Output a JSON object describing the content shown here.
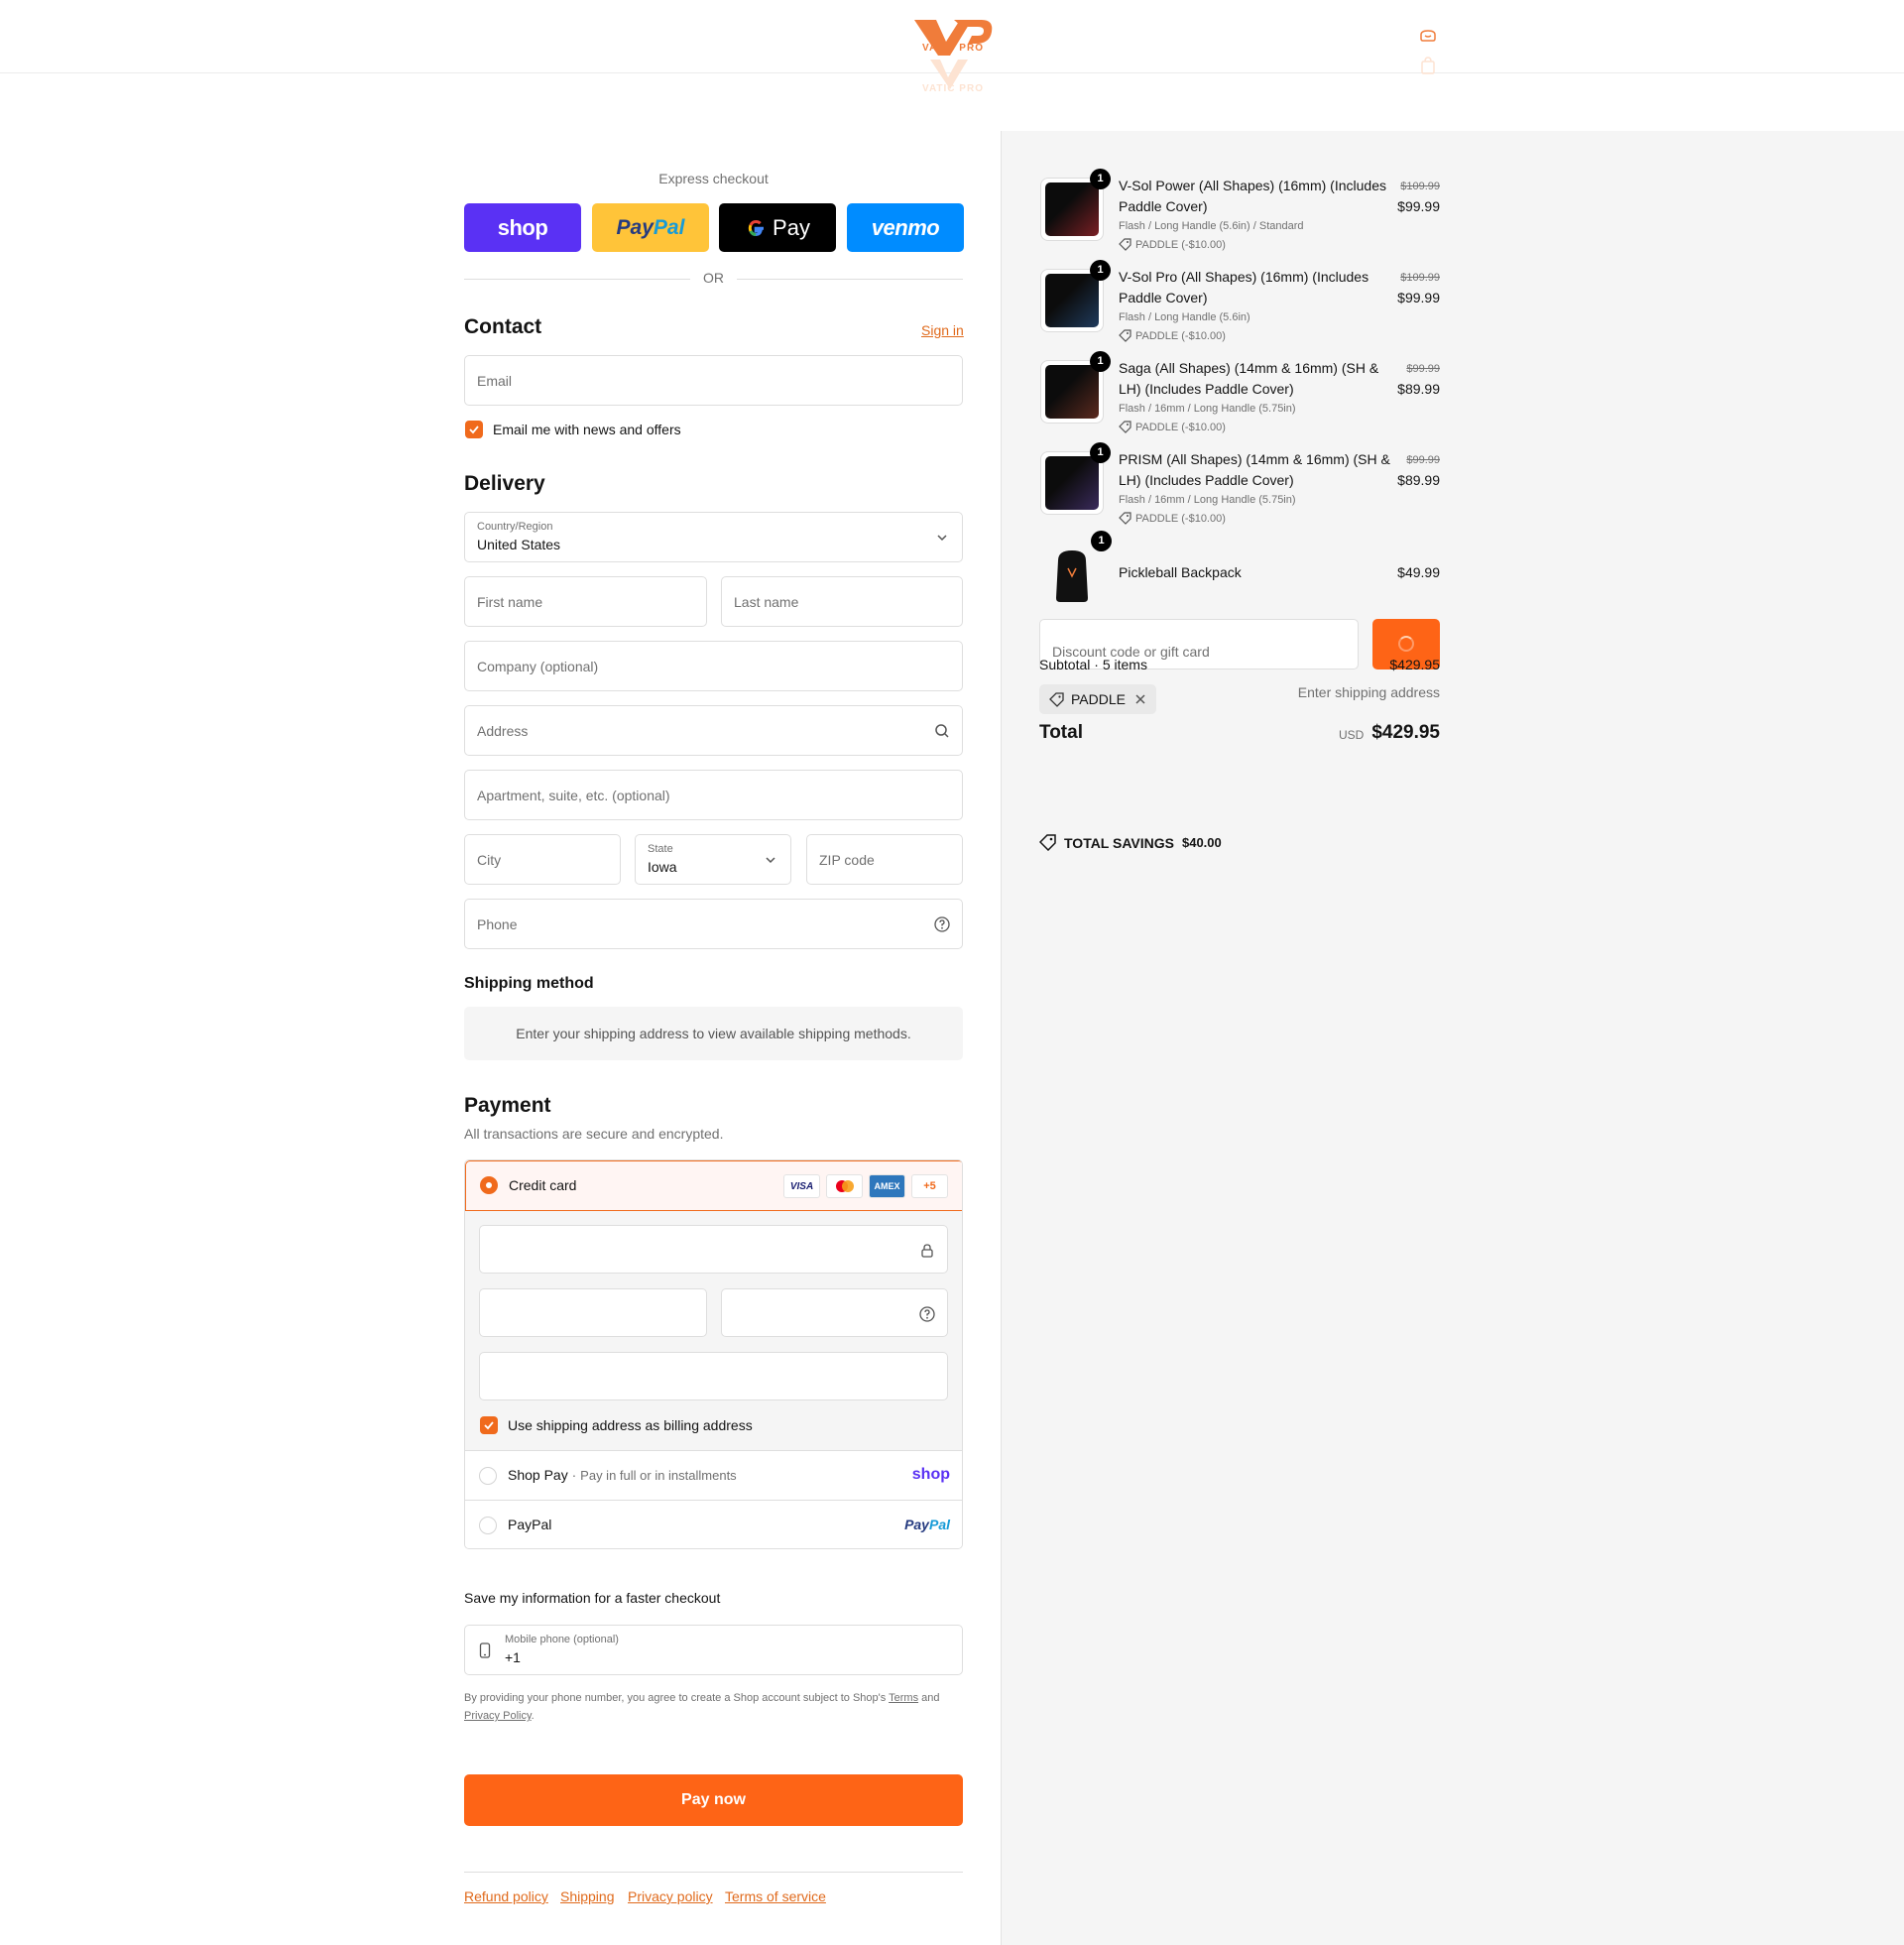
{
  "brand": {
    "name": "VATIC PRO",
    "accent": "#fe6416"
  },
  "header": {
    "account_icon": "account-icon",
    "cart_icon": "bag-icon"
  },
  "express": {
    "label": "Express checkout",
    "buttons": {
      "shop": "shop",
      "paypal_1": "Pay",
      "paypal_2": "Pal",
      "gpay": "Pay",
      "venmo": "venmo"
    },
    "or": "OR"
  },
  "contact": {
    "title": "Contact",
    "sign_in": "Sign in",
    "email_placeholder": "Email",
    "news_label": "Email me with news and offers"
  },
  "delivery": {
    "title": "Delivery",
    "country_label": "Country/Region",
    "country_value": "United States",
    "first_name": "First name",
    "last_name": "Last name",
    "company": "Company (optional)",
    "address": "Address",
    "apartment": "Apartment, suite, etc. (optional)",
    "city": "City",
    "state_label": "State",
    "state_value": "Iowa",
    "zip": "ZIP code",
    "phone": "Phone"
  },
  "shipping": {
    "title": "Shipping method",
    "notice": "Enter your shipping address to view available shipping methods."
  },
  "payment": {
    "title": "Payment",
    "subtitle": "All transactions are secure and encrypted.",
    "credit_card": "Credit card",
    "card_logos": {
      "visa": "VISA",
      "amex": "AMEX",
      "more": "+5"
    },
    "billing_label": "Use shipping address as billing address",
    "shop_pay": "Shop Pay",
    "shop_pay_sub": "Pay in full or in installments",
    "shop_pay_logo": "shop",
    "paypal": "PayPal",
    "paypal_logo_1": "Pay",
    "paypal_logo_2": "Pal"
  },
  "save_info": {
    "title": "Save my information for a faster checkout",
    "mobile_label": "Mobile phone (optional)",
    "mobile_value": "+1",
    "legal_1": "By providing your phone number, you agree to create a Shop account subject to Shop's",
    "terms": "Terms",
    "legal_and": "and",
    "privacy": "Privacy Policy",
    "legal_end": "."
  },
  "pay_now": "Pay now",
  "footer": {
    "refund": "Refund policy",
    "shipping": "Shipping",
    "privacy": "Privacy policy",
    "terms": "Terms of service"
  },
  "items": [
    {
      "qty": "1",
      "name": "V-Sol Power (All Shapes) (16mm) (Includes Paddle Cover)",
      "variant": "Flash / Long Handle (5.6in) / Standard",
      "discount": "PADDLE (-$10.00)",
      "old_price": "$109.99",
      "price": "$99.99",
      "color": "#7a1f24"
    },
    {
      "qty": "1",
      "name": "V-Sol Pro (All Shapes) (16mm) (Includes Paddle Cover)",
      "variant": "Flash / Long Handle (5.6in)",
      "discount": "PADDLE (-$10.00)",
      "old_price": "$109.99",
      "price": "$99.99",
      "color": "#1f3a5c"
    },
    {
      "qty": "1",
      "name": "Saga (All Shapes) (14mm & 16mm) (SH & LH) (Includes Paddle Cover)",
      "variant": "Flash / 16mm / Long Handle (5.75in)",
      "discount": "PADDLE (-$10.00)",
      "old_price": "$99.99",
      "price": "$89.99",
      "color": "#5c2a1f"
    },
    {
      "qty": "1",
      "name": "PRISM (All Shapes) (14mm & 16mm) (SH & LH) (Includes Paddle Cover)",
      "variant": "Flash / 16mm / Long Handle (5.75in)",
      "discount": "PADDLE (-$10.00)",
      "old_price": "$99.99",
      "price": "$89.99",
      "color": "#3a2a5c"
    },
    {
      "qty": "1",
      "name": "Pickleball Backpack",
      "price": "$49.99",
      "color": "#111111"
    }
  ],
  "summary": {
    "discount_placeholder": "Discount code or gift card",
    "subtotal_label": "Subtotal · 5 items",
    "subtotal_value": "$429.95",
    "code_chip": "PADDLE",
    "shipping_value": "Enter shipping address",
    "total_label": "Total",
    "currency": "USD",
    "total_value": "$429.95",
    "savings_label": "TOTAL SAVINGS",
    "savings_value": "$40.00"
  }
}
